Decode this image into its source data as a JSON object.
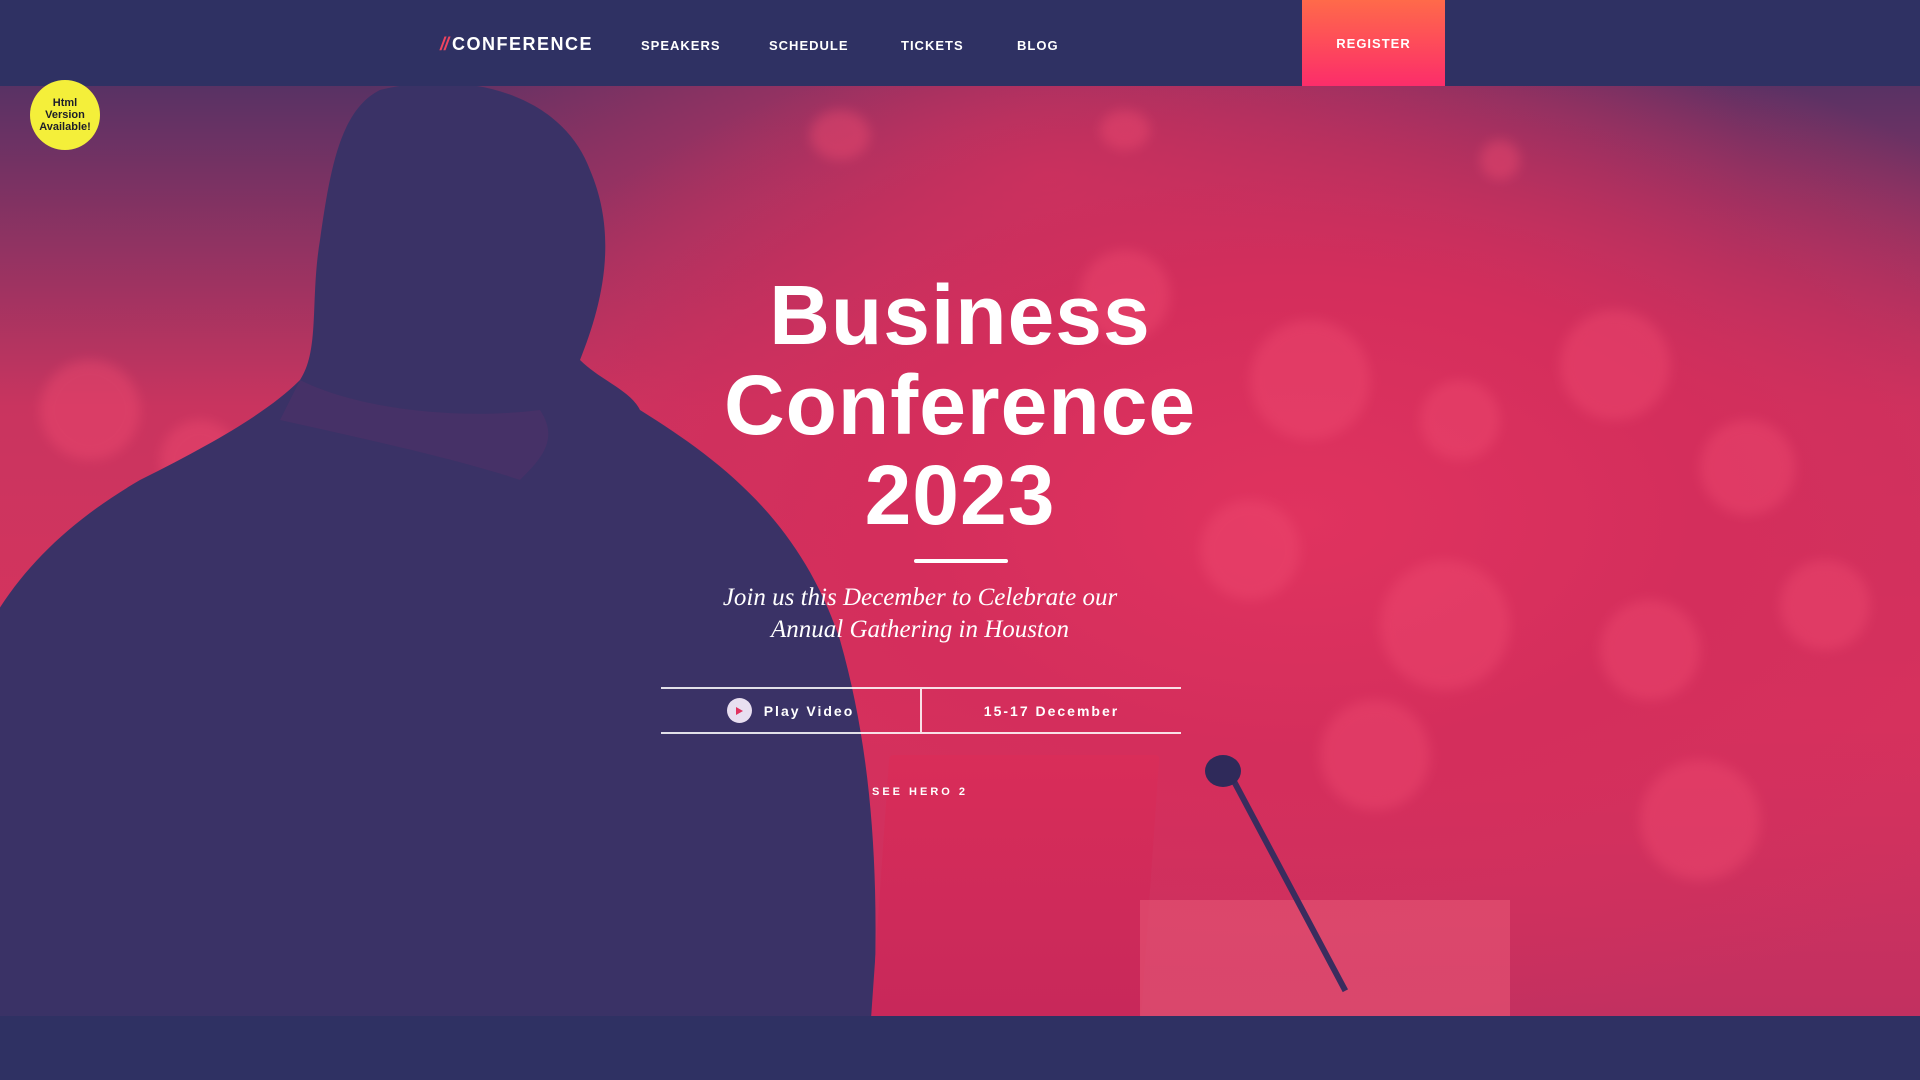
{
  "nav": {
    "logo_mark": "//",
    "logo_text": "CONFERENCE",
    "items": [
      {
        "label": "SPEAKERS"
      },
      {
        "label": "SCHEDULE"
      },
      {
        "label": "TICKETS"
      },
      {
        "label": "BLOG"
      }
    ],
    "register_label": "REGISTER"
  },
  "badge": {
    "line1": "Html",
    "line2": "Version",
    "line3": "Available!"
  },
  "hero": {
    "title_line1": "Business",
    "title_line2": "Conference",
    "title_line3": "2023",
    "subtitle_line1": "Join us this December to Celebrate our",
    "subtitle_line2": "Annual Gathering in Houston",
    "play_label": "Play Video",
    "dates_label": "15-17 December",
    "see_hero_label": "SEE HERO 2",
    "play_icon": "play-icon"
  },
  "colors": {
    "navy": "#2f3163",
    "accent_pink": "#f0445f",
    "register_gradient_top": "#ff6a4a",
    "register_gradient_bottom": "#fc2d6a",
    "badge_yellow": "#f4ef3a"
  }
}
